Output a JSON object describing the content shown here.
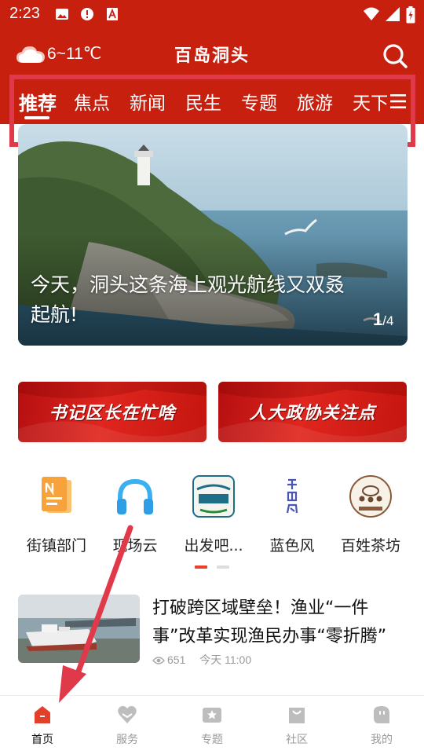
{
  "status": {
    "time": "2:23",
    "left_icons": [
      "image-icon",
      "alert-icon",
      "a-badge-icon"
    ],
    "right_icons": [
      "wifi-icon",
      "signal-icon",
      "battery-icon"
    ]
  },
  "header": {
    "weather": "6~11℃",
    "title": "百岛洞头",
    "weather_icon": "cloud-icon",
    "search_icon": "search-icon",
    "bg_color": "#c8200f"
  },
  "tabs": [
    {
      "label": "推荐",
      "active": true
    },
    {
      "label": "焦点",
      "active": false
    },
    {
      "label": "新闻",
      "active": false
    },
    {
      "label": "民生",
      "active": false
    },
    {
      "label": "专题",
      "active": false
    },
    {
      "label": "旅游",
      "active": false
    },
    {
      "label": "天下",
      "active": false
    }
  ],
  "banner": {
    "title": "今天，洞头这条海上观光航线又双叒起航!",
    "counter_current": "1",
    "counter_total": "/4"
  },
  "promos": [
    {
      "label": "书记区长在忙啥"
    },
    {
      "label": "人大政协关注点"
    }
  ],
  "quick_links": [
    {
      "label": "街镇部门",
      "icon": "document-icon"
    },
    {
      "label": "现场云",
      "icon": "headphones-icon"
    },
    {
      "label": "出发吧...",
      "icon": "go-logo-icon"
    },
    {
      "label": "蓝色风",
      "icon": "blue-wind-logo-icon"
    },
    {
      "label": "百姓茶坊",
      "icon": "teahouse-logo-icon"
    }
  ],
  "news": [
    {
      "title": "打破跨区域壁垒！渔业“一件事”改革实现渔民办事“零折腾”",
      "views": "651",
      "time": "今天 11:00"
    }
  ],
  "bottom_nav": [
    {
      "label": "首页",
      "icon": "home-icon",
      "active": true
    },
    {
      "label": "服务",
      "icon": "heart-icon",
      "active": false
    },
    {
      "label": "专题",
      "icon": "star-icon",
      "active": false
    },
    {
      "label": "社区",
      "icon": "bag-icon",
      "active": false
    },
    {
      "label": "我的",
      "icon": "profile-icon",
      "active": false
    }
  ],
  "colors": {
    "accent": "#c8200f",
    "annotation": "#e03a4a"
  }
}
